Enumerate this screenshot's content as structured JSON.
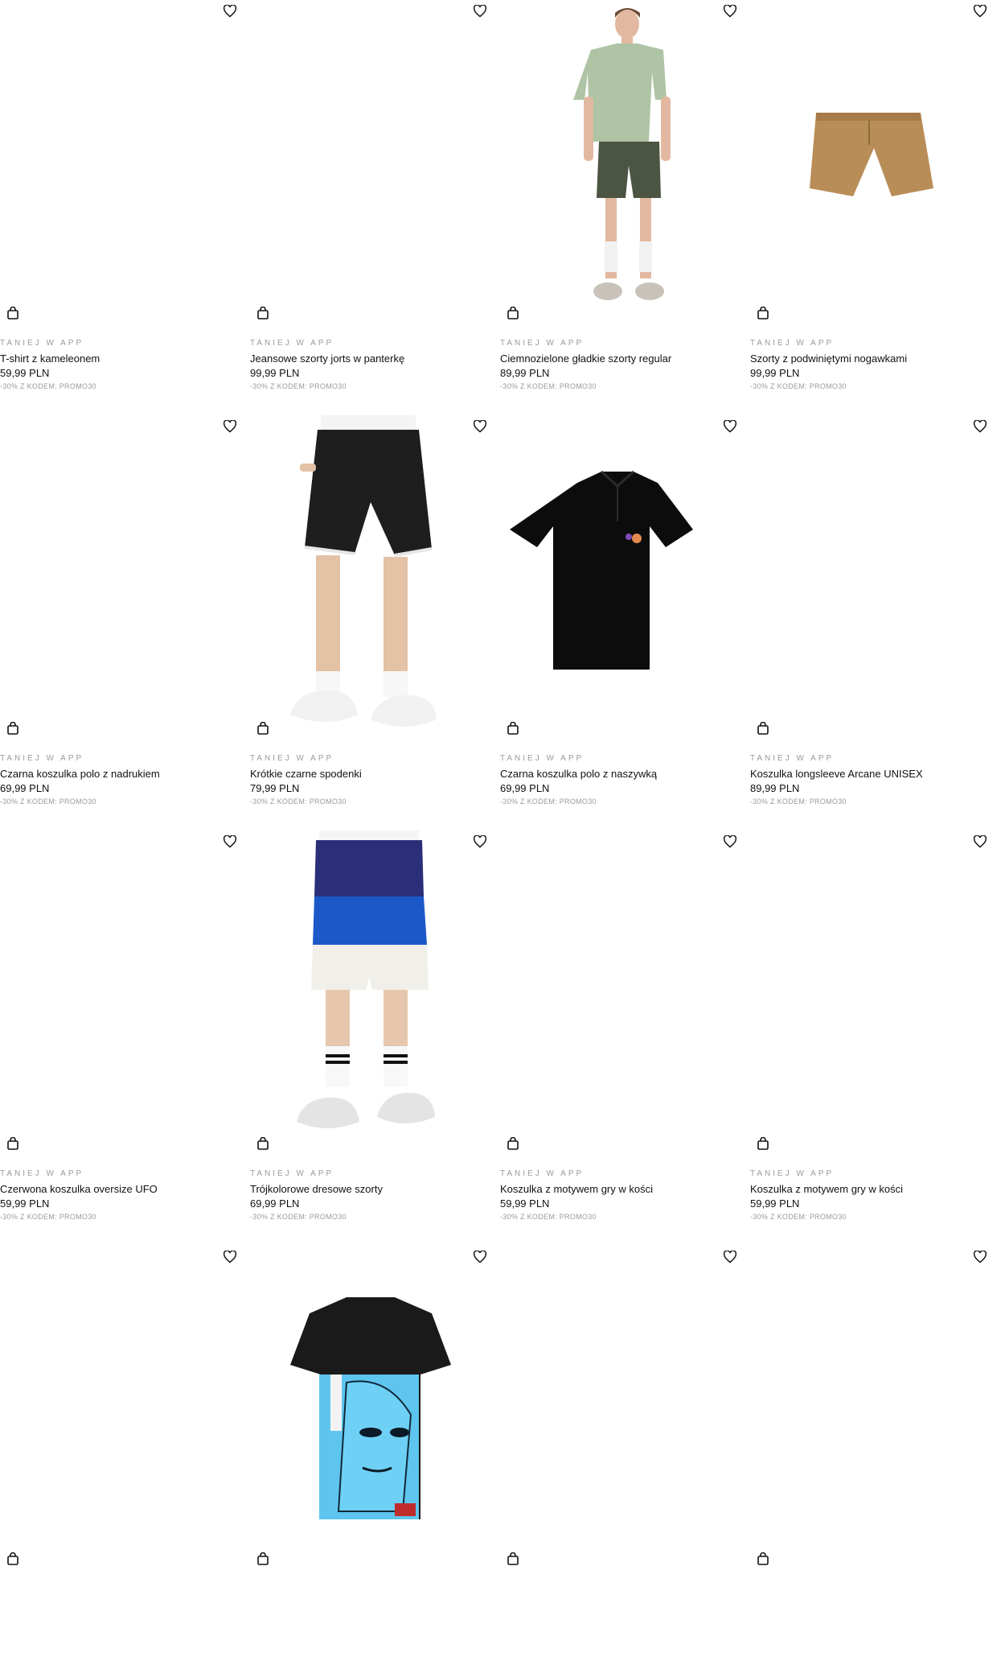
{
  "products": [
    {
      "tag": "TANIEJ W APP",
      "name": "T-shirt z kameleonem",
      "price": "59,99 PLN",
      "code": "-30% Z KODEM: PROMO30",
      "image": "none"
    },
    {
      "tag": "TANIEJ W APP",
      "name": "Jeansowe szorty jorts w panterkę",
      "price": "99,99 PLN",
      "code": "-30% Z KODEM: PROMO30",
      "image": "none"
    },
    {
      "tag": "TANIEJ W APP",
      "name": "Ciemnozielone gładkie szorty regular",
      "price": "89,99 PLN",
      "code": "-30% Z KODEM: PROMO30",
      "image": "model-green-tshirt"
    },
    {
      "tag": "TANIEJ W APP",
      "name": "Szorty z podwiniętymi nogawkami",
      "price": "99,99 PLN",
      "code": "-30% Z KODEM: PROMO30",
      "image": "khaki-shorts"
    },
    {
      "tag": "TANIEJ W APP",
      "name": "Czarna koszulka polo z nadrukiem",
      "price": "69,99 PLN",
      "code": "-30% Z KODEM: PROMO30",
      "image": "none"
    },
    {
      "tag": "TANIEJ W APP",
      "name": "Krótkie czarne spodenki",
      "price": "79,99 PLN",
      "code": "-30% Z KODEM: PROMO30",
      "image": "black-shorts-model"
    },
    {
      "tag": "TANIEJ W APP",
      "name": "Czarna koszulka polo z naszywką",
      "price": "69,99 PLN",
      "code": "-30% Z KODEM: PROMO30",
      "image": "black-polo"
    },
    {
      "tag": "TANIEJ W APP",
      "name": "Koszulka longsleeve Arcane UNISEX",
      "price": "89,99 PLN",
      "code": "-30% Z KODEM: PROMO30",
      "image": "none"
    },
    {
      "tag": "TANIEJ W APP",
      "name": "Czerwona koszulka oversize UFO",
      "price": "59,99 PLN",
      "code": "-30% Z KODEM: PROMO30",
      "image": "none"
    },
    {
      "tag": "TANIEJ W APP",
      "name": "Trójkolorowe dresowe szorty",
      "price": "69,99 PLN",
      "code": "-30% Z KODEM: PROMO30",
      "image": "tricolor-shorts-model"
    },
    {
      "tag": "TANIEJ W APP",
      "name": "Koszulka z motywem gry w kości",
      "price": "59,99 PLN",
      "code": "-30% Z KODEM: PROMO30",
      "image": "none"
    },
    {
      "tag": "TANIEJ W APP",
      "name": "Koszulka z motywem gry w kości",
      "price": "59,99 PLN",
      "code": "-30% Z KODEM: PROMO30",
      "image": "none"
    },
    {
      "tag": "",
      "name": "",
      "price": "",
      "code": "",
      "image": "none"
    },
    {
      "tag": "",
      "name": "",
      "price": "",
      "code": "",
      "image": "anime-tshirt"
    },
    {
      "tag": "",
      "name": "",
      "price": "",
      "code": "",
      "image": "none"
    },
    {
      "tag": "",
      "name": "",
      "price": "",
      "code": "",
      "image": "none"
    }
  ],
  "icons": {
    "favorite": "heart-icon",
    "cart": "shopping-bag-icon"
  }
}
